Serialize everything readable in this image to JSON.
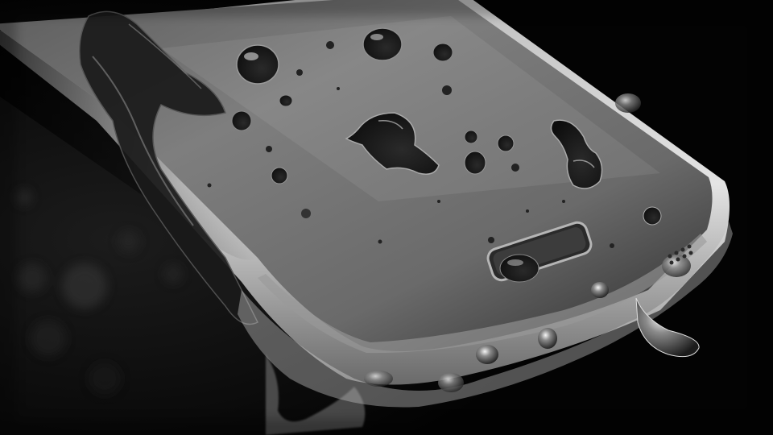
{
  "photo": {
    "subject": "phone-with-water-droplets",
    "palette": {
      "background": "#050505",
      "screen_light": "#7c7c7c",
      "screen_mid": "#4a4a4a",
      "screen_dark": "#1a1a1a",
      "frame_highlight": "#d8d8d8",
      "water_highlight": "#f2f2f2"
    }
  }
}
